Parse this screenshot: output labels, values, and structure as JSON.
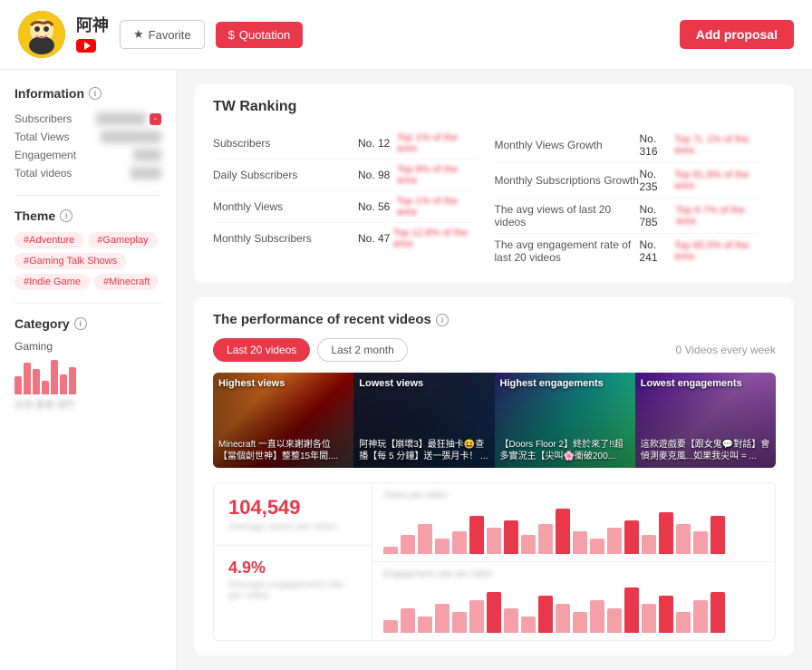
{
  "header": {
    "channel_name": "阿神",
    "avatar_emoji": "😺",
    "favorite_label": "Favorite",
    "quotation_label": "Quotation",
    "add_proposal_label": "Add proposal"
  },
  "sidebar": {
    "information_title": "Information",
    "subscribers_label": "Subscribers",
    "total_views_label": "Total Views",
    "engagement_label": "Engagement",
    "total_videos_label": "Total videos",
    "theme_title": "Theme",
    "category_title": "Category",
    "category_value": "Gaming",
    "tags": [
      "#Adventure",
      "#Gameplay",
      "#Gaming Talk Shows",
      "#Indie Game",
      "#Minecraft"
    ]
  },
  "ranking": {
    "title": "TW Ranking",
    "items_left": [
      {
        "label": "Subscribers",
        "rank": "No. 12",
        "tag": "Top 1% of the area"
      },
      {
        "label": "Daily Subscribers",
        "rank": "No. 98",
        "tag": "Top 8% of the area"
      },
      {
        "label": "Monthly Views",
        "rank": "No. 56",
        "tag": "Top 1% of the area"
      },
      {
        "label": "Monthly Subscribers",
        "rank": "No. 47",
        "tag": "Top 12.8% of the area"
      }
    ],
    "items_right": [
      {
        "label": "Monthly Views Growth",
        "rank": "No. 316",
        "tag": "Top 7L 1% of the area"
      },
      {
        "label": "Monthly Subscriptions Growth",
        "rank": "No. 235",
        "tag": "Top 81.8% of the area"
      },
      {
        "label": "The avg views of last 20 videos",
        "rank": "No. 785",
        "tag": "Top 8.7% of the area"
      },
      {
        "label": "The avg engagement rate of last 20 videos",
        "rank": "No. 241",
        "tag": "Top 85.5% of the area"
      }
    ]
  },
  "performance": {
    "title": "The performance of recent videos",
    "tab_last20": "Last 20 videos",
    "tab_last2month": "Last 2 month",
    "videos_per_week": "0 Videos every week",
    "videos": [
      {
        "category": "Highest views",
        "title": "Minecraft 一直以來謝謝各位【當個創世神】整整15年間...."
      },
      {
        "category": "Lowest views",
        "title": "阿神玩【崩壞3】最狂抽卡😆查播【每 5 分鐘】送一張月卡！ ..."
      },
      {
        "category": "Highest engagements",
        "title": "【Doors Floor 2】終於來了!!超多實況主【尖叫🌸衝破200..."
      },
      {
        "category": "Lowest engagements",
        "title": "這款遊戲要【跟女鬼💬對話】會偵測麥克風...如果我尖叫 = ..."
      }
    ],
    "stat1_num": "104,549",
    "stat1_sub": "Average views per video",
    "stat2_num": "4.9%",
    "stat2_sub": "Average engagement rate per video",
    "chart1_bars": [
      2,
      5,
      8,
      4,
      6,
      10,
      7,
      9,
      5,
      8,
      12,
      6,
      4,
      7,
      9,
      5,
      11,
      8,
      6,
      10
    ],
    "chart2_bars": [
      3,
      6,
      4,
      7,
      5,
      8,
      10,
      6,
      4,
      9,
      7,
      5,
      8,
      6,
      11,
      7,
      9,
      5,
      8,
      10
    ]
  }
}
